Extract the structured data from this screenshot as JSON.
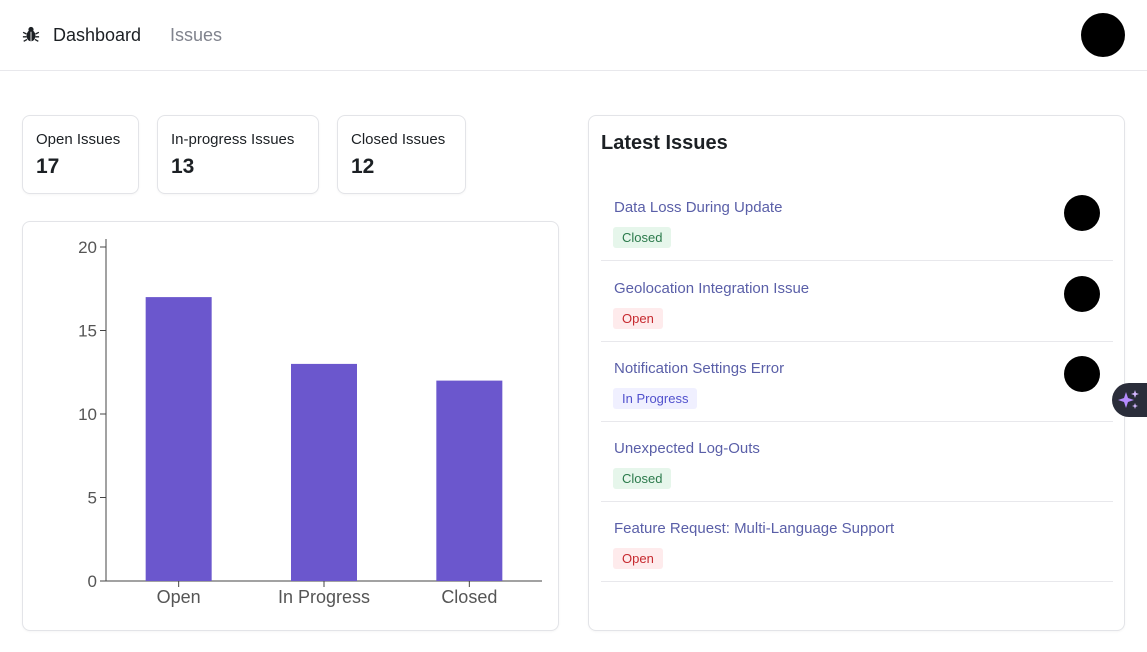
{
  "nav": {
    "logo_icon": "bug-icon",
    "dashboard_label": "Dashboard",
    "issues_label": "Issues",
    "avatar_icon": "user-avatar"
  },
  "stats": [
    {
      "label": "Open Issues",
      "value": "17"
    },
    {
      "label": "In-progress Issues",
      "value": "13"
    },
    {
      "label": "Closed Issues",
      "value": "12"
    }
  ],
  "chart_data": {
    "type": "bar",
    "categories": [
      "Open",
      "In Progress",
      "Closed"
    ],
    "values": [
      17,
      13,
      12
    ],
    "y_ticks": [
      0,
      5,
      10,
      15,
      20
    ],
    "ylim": [
      0,
      20
    ],
    "bar_color": "#6b57cd",
    "title": "",
    "xlabel": "",
    "ylabel": ""
  },
  "latest": {
    "title": "Latest Issues",
    "issues": [
      {
        "title": "Data Loss During Update",
        "status": "Closed",
        "has_avatar": true
      },
      {
        "title": "Geolocation Integration Issue",
        "status": "Open",
        "has_avatar": true
      },
      {
        "title": "Notification Settings Error",
        "status": "In Progress",
        "has_avatar": true
      },
      {
        "title": "Unexpected Log-Outs",
        "status": "Closed",
        "has_avatar": false
      },
      {
        "title": "Feature Request: Multi-Language Support",
        "status": "Open",
        "has_avatar": false
      }
    ]
  },
  "colors": {
    "accent": "#6b57cd",
    "closed_bg": "#e6f6eb",
    "open_bg": "#feebec",
    "progress_bg": "#f0f0ff"
  },
  "assistant_icon": "sparkle-icon"
}
